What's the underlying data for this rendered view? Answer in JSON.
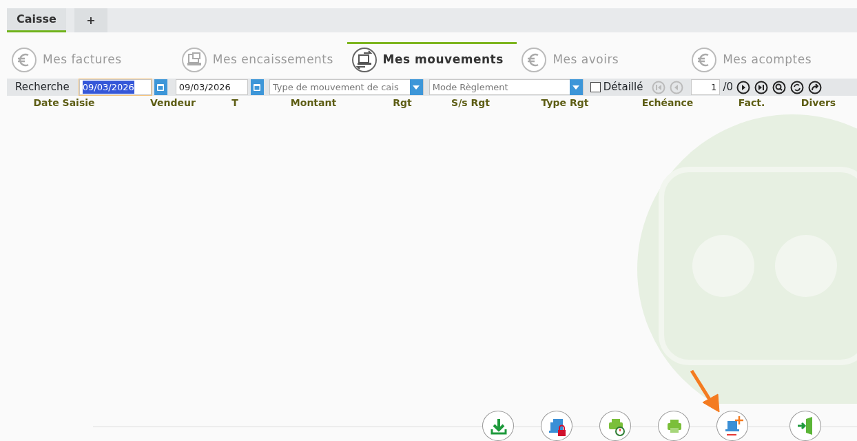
{
  "window_tabs": [
    {
      "label": "Caisse",
      "selected": true
    },
    {
      "label": "+",
      "selected": false
    }
  ],
  "sections": [
    {
      "label": "Mes factures",
      "kind": "euro",
      "selected": false
    },
    {
      "label": "Mes encaissements",
      "kind": "register",
      "selected": false
    },
    {
      "label": "Mes mouvements",
      "kind": "transfer",
      "selected": true
    },
    {
      "label": "Mes avoirs",
      "kind": "euro",
      "selected": false
    },
    {
      "label": "Mes acomptes",
      "kind": "euro",
      "selected": false
    }
  ],
  "search": {
    "label": "Recherche",
    "date_from": {
      "value": "09/03/2026",
      "highlighted": true
    },
    "date_to": {
      "value": "09/03/2026",
      "highlighted": false
    },
    "type_placeholder": "Type de mouvement de cais",
    "mode_placeholder": "Mode Règlement",
    "detailed": {
      "label": "Détaillé",
      "checked": false
    },
    "page": "1",
    "page_total": "/0"
  },
  "table": {
    "columns": [
      "Date Saisie",
      "Vendeur",
      "T",
      "Montant",
      "Rgt",
      "S/s Rgt",
      "Type Rgt",
      "Echéance",
      "Fact.",
      "Divers"
    ]
  },
  "actions": [
    {
      "kind": "download"
    },
    {
      "kind": "register-lock"
    },
    {
      "kind": "print-timer"
    },
    {
      "kind": "print"
    },
    {
      "kind": "register-add"
    },
    {
      "kind": "exit"
    }
  ]
}
